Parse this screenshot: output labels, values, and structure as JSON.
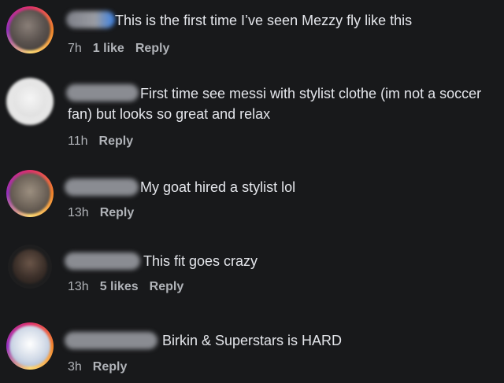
{
  "comments": [
    {
      "text": "This is the first time I’ve seen Mezzy fly like this",
      "time": "7h",
      "likes": "1 like",
      "reply": "Reply"
    },
    {
      "text": "First time see messi with stylist clothe (im not a soccer fan) but looks so great and relax",
      "time": "11h",
      "likes": "",
      "reply": "Reply"
    },
    {
      "text": "My goat hired a stylist lol",
      "time": "13h",
      "likes": "",
      "reply": "Reply"
    },
    {
      "text": "This fit goes crazy",
      "time": "13h",
      "likes": "5 likes",
      "reply": "Reply"
    },
    {
      "text": "Birkin & Superstars is HARD",
      "time": "3h",
      "likes": "",
      "reply": "Reply"
    }
  ]
}
